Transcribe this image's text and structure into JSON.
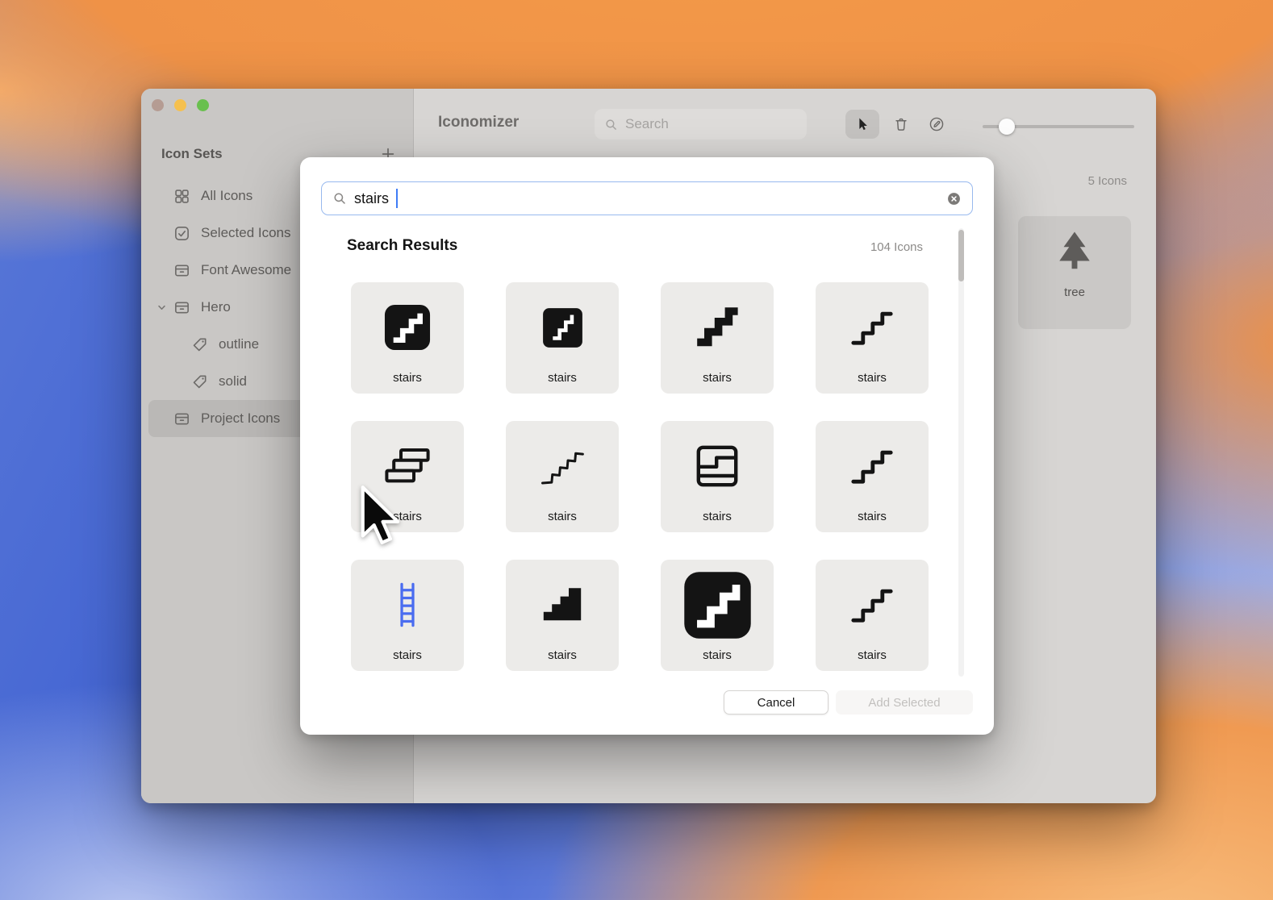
{
  "colors": {
    "caret": "#3f7df6",
    "ladder": "#4a6cf0",
    "focus_border": "#98b9ee",
    "traffic_red": "#b59c93",
    "traffic_yellow": "#f5c04e",
    "traffic_green": "#69c04e"
  },
  "window": {
    "title": "Iconomizer",
    "toolbar": {
      "search_placeholder": "Search",
      "tools": [
        {
          "name": "select-cursor"
        },
        {
          "name": "delete"
        },
        {
          "name": "annotate"
        }
      ],
      "slider_fraction": 0.16
    },
    "sidebar": {
      "header": "Icon Sets",
      "items": [
        {
          "label": "All Icons",
          "icon": "grid"
        },
        {
          "label": "Selected Icons",
          "icon": "checkbox-checked"
        },
        {
          "label": "Font Awesome",
          "icon": "archive-box"
        },
        {
          "label": "Hero",
          "icon": "archive-box",
          "expanded": true
        },
        {
          "label": "outline",
          "icon": "tag",
          "indent": true
        },
        {
          "label": "solid",
          "icon": "tag",
          "indent": true
        },
        {
          "label": "Project Icons",
          "icon": "archive-box",
          "selected": true
        }
      ]
    },
    "collection": {
      "count_label": "5 Icons",
      "items": [
        {
          "label": "tree",
          "icon": "tree"
        }
      ]
    }
  },
  "modal": {
    "search": {
      "value": "stairs"
    },
    "results": {
      "header": "Search Results",
      "count_label": "104 Icons"
    },
    "icons": [
      {
        "label": "stairs",
        "icon": "stairs-square-solid"
      },
      {
        "label": "stairs",
        "icon": "stairs-square-solid-alt"
      },
      {
        "label": "stairs",
        "icon": "stairs-steps-bold"
      },
      {
        "label": "stairs",
        "icon": "stairs-steps-line"
      },
      {
        "label": "stairs",
        "icon": "stairs-3d"
      },
      {
        "label": "stairs",
        "icon": "stairs-zigzag"
      },
      {
        "label": "stairs",
        "icon": "stairs-floorplan"
      },
      {
        "label": "stairs",
        "icon": "stairs-steps-line"
      },
      {
        "label": "stairs",
        "icon": "ladder"
      },
      {
        "label": "stairs",
        "icon": "stairs-filled"
      },
      {
        "label": "stairs",
        "icon": "stairs-square-solid-large"
      },
      {
        "label": "stairs",
        "icon": "stairs-steps-line"
      }
    ],
    "footer": {
      "cancel_label": "Cancel",
      "add_label": "Add Selected"
    }
  }
}
